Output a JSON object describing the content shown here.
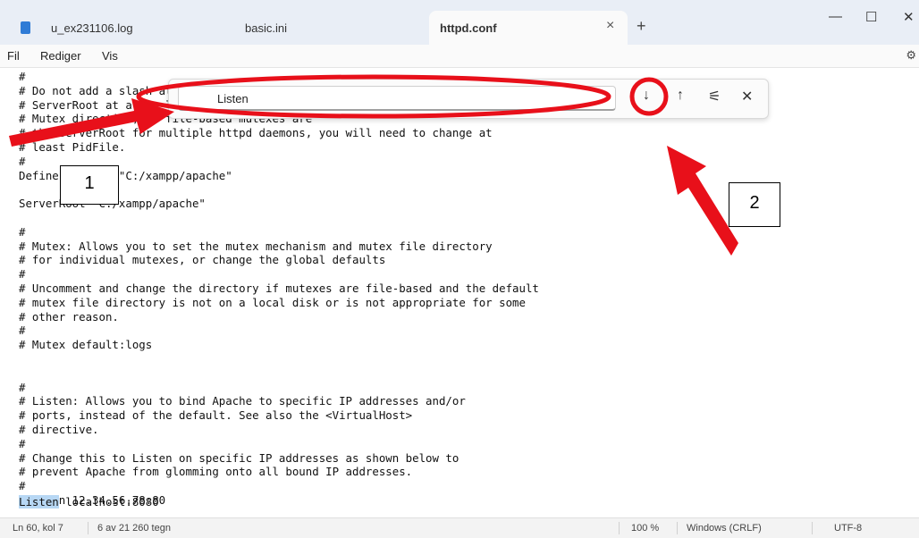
{
  "tabs": [
    {
      "label": "u_ex231106.log"
    },
    {
      "label": "basic.ini"
    },
    {
      "label": "httpd.conf",
      "active": true
    }
  ],
  "tab_close": "×",
  "new_tab": "+",
  "window": {
    "minimize": "—",
    "maximize": "☐",
    "close": "✕"
  },
  "menu": [
    "Fil",
    "Rediger",
    "Vis"
  ],
  "settings_icon": "⚙",
  "editor_lines": [
    "#",
    "# Do not add a slash at",
    "# ServerRoot at a non-l",
    "# Mutex directive, if file-based mutexes are",
    "# the ServerRoot for multiple httpd daemons, you will need to change at",
    "# least PidFile.",
    "#",
    "Define SRVROOT \"C:/xampp/apache\"",
    "",
    "ServerRoot \"C:/xampp/apache\"",
    "",
    "#",
    "# Mutex: Allows you to set the mutex mechanism and mutex file directory",
    "# for individual mutexes, or change the global defaults",
    "#",
    "# Uncomment and change the directory if mutexes are file-based and the default",
    "# mutex file directory is not on a local disk or is not appropriate for some",
    "# other reason.",
    "#",
    "# Mutex default:logs",
    "",
    "",
    "#",
    "# Listen: Allows you to bind Apache to specific IP addresses and/or",
    "# ports, instead of the default. See also the <VirtualHost>",
    "# directive.",
    "#",
    "# Change this to Listen on specific IP addresses as shown below to",
    "# prevent Apache from glomming onto all bound IP addresses.",
    "#",
    "#Listen 12.34.56.78:80"
  ],
  "last_line": {
    "highlight": "Listen",
    "rest": " localhost:8080"
  },
  "find": {
    "value": "Listen",
    "next": "↓",
    "prev": "↑",
    "options": "⚟",
    "close": "✕"
  },
  "annotations": {
    "label1": "1",
    "label2": "2",
    "color": "#e8101a"
  },
  "status": {
    "position": "Ln 60, kol 7",
    "count": "6 av 21 260 tegn",
    "zoom": "100 %",
    "eol": "Windows (CRLF)",
    "encoding": "UTF-8"
  }
}
